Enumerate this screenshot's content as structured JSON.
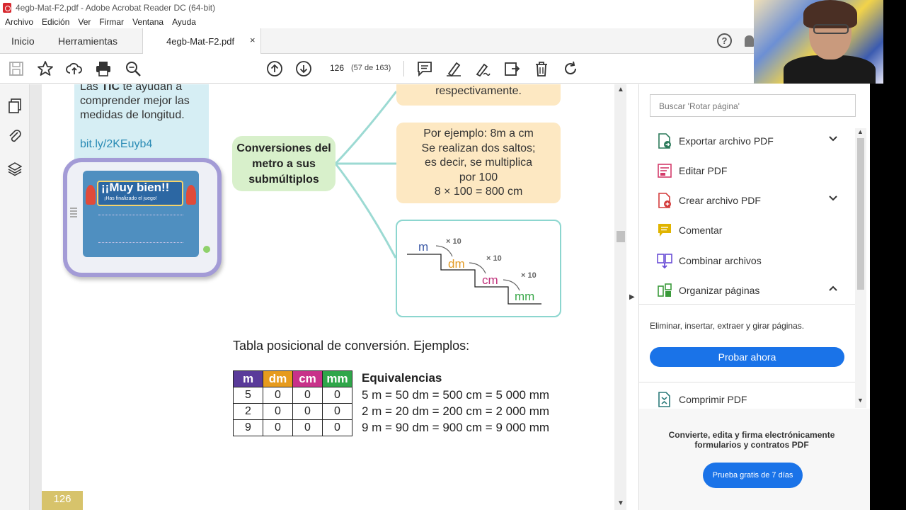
{
  "window": {
    "title": "4egb-Mat-F2.pdf - Adobe Acrobat Reader DC (64-bit)"
  },
  "menu": [
    "Archivo",
    "Edición",
    "Ver",
    "Firmar",
    "Ventana",
    "Ayuda"
  ],
  "tabs": {
    "home": "Inicio",
    "tools": "Herramientas",
    "doc": "4egb-Mat-F2.pdf",
    "close": "×",
    "help": "?"
  },
  "toolbar": {
    "page_number": "126",
    "page_of": "(57 de 163)"
  },
  "page": {
    "tic_text": "Las TIC te ayudan a comprender mejor las medidas de longitud.",
    "tic_link": "bit.ly/2KEuyb4",
    "tablet_title": "¡¡Muy bien!!",
    "tablet_sub": "¡Has finalizado el juego!",
    "center_node": "Conversiones del metro a sus submúltiplos",
    "box_top": "respectivamente.",
    "example_lines": [
      "Por ejemplo: 8m a cm",
      "Se realizan dos saltos;",
      "es decir, se multiplica",
      "por 100",
      "8 × 100 = 800 cm"
    ],
    "stairs": {
      "units": [
        "m",
        "dm",
        "cm",
        "mm"
      ],
      "unit_colors": [
        "#3c5aa6",
        "#e39b25",
        "#c0307a",
        "#3aa84a"
      ],
      "multiplier": "× 10"
    },
    "table_title": "Tabla posicional de conversión. Ejemplos:",
    "table_headers": [
      "m",
      "dm",
      "cm",
      "mm"
    ],
    "table_header_colors": [
      "#5a3b9a",
      "#e69b1e",
      "#c8328a",
      "#2fa64a"
    ],
    "table_rows": [
      [
        "5",
        "0",
        "0",
        "0"
      ],
      [
        "2",
        "0",
        "0",
        "0"
      ],
      [
        "9",
        "0",
        "0",
        "0"
      ]
    ],
    "equiv_title": "Equivalencias",
    "equiv_rows": [
      "5 m = 50 dm = 500 cm = 5 000 mm",
      "2 m = 20 dm = 200 cm = 2 000 mm",
      "9 m = 90 dm = 900 cm = 9 000 mm"
    ],
    "page_number": "126"
  },
  "right_panel": {
    "search_placeholder": "Buscar 'Rotar página'",
    "items": [
      {
        "label": "Exportar archivo PDF",
        "chevron": "⌄",
        "color": "#2b7a5a"
      },
      {
        "label": "Editar PDF",
        "chevron": "",
        "color": "#d43b6a"
      },
      {
        "label": "Crear archivo PDF",
        "chevron": "⌄",
        "color": "#d43b3b"
      },
      {
        "label": "Comentar",
        "chevron": "",
        "color": "#e0b400"
      },
      {
        "label": "Combinar archivos",
        "chevron": "",
        "color": "#6b4fd6"
      },
      {
        "label": "Organizar páginas",
        "chevron": "⌃",
        "color": "#3a9a3a"
      }
    ],
    "organize_desc": "Eliminar, insertar, extraer y girar páginas.",
    "try_button": "Probar ahora",
    "compress": "Comprimir PDF",
    "promo_text": "Convierte, edita y firma electrónicamente formularios y contratos PDF",
    "promo_button": "Prueba gratis de 7 días"
  }
}
